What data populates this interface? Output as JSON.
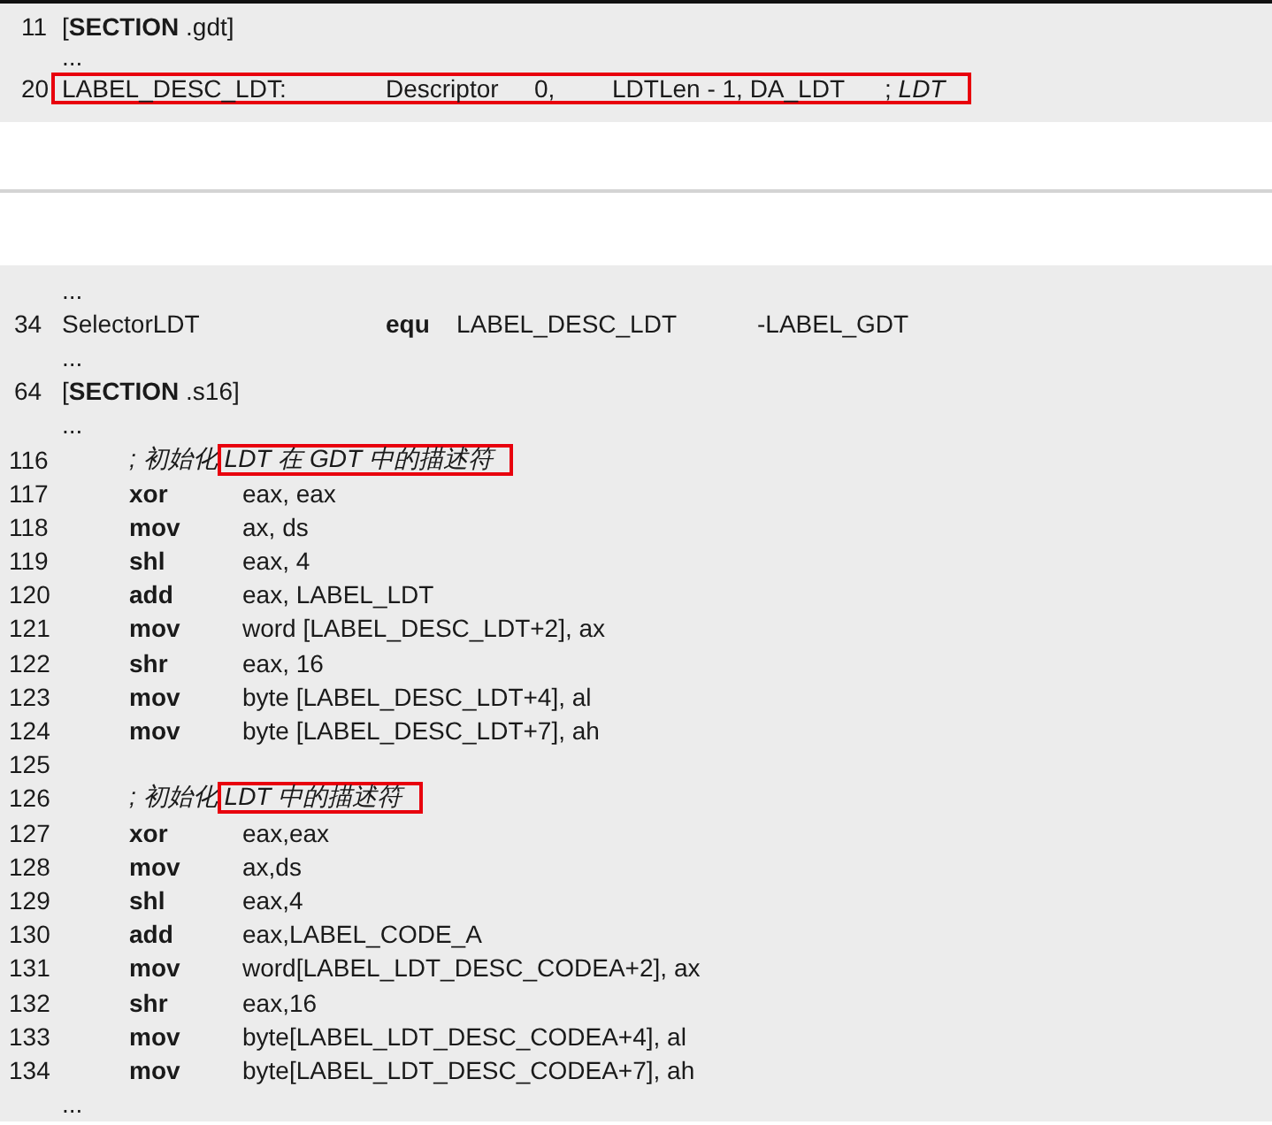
{
  "panels": [
    {
      "lines": [
        {
          "kind": "section",
          "num": "11",
          "text": "[**SECTION** .gdt]"
        },
        {
          "kind": "ellipsis",
          "text": "..."
        },
        {
          "kind": "directive",
          "num": "20",
          "highlighted": true,
          "label": "LABEL_DESC_LDT:",
          "macro": "Descriptor",
          "args": [
            "0,",
            "LDTLen - 1, DA_LDT"
          ],
          "comment": "; *LDT*"
        }
      ]
    },
    {
      "lines": [
        {
          "kind": "ellipsis",
          "text": "..."
        },
        {
          "kind": "equate",
          "num": "34",
          "label": "SelectorLDT",
          "op": "equ",
          "args": [
            "LABEL_DESC_LDT",
            "-LABEL_GDT"
          ]
        },
        {
          "kind": "ellipsis",
          "text": "..."
        },
        {
          "kind": "section",
          "num": "64",
          "text": "[**SECTION** .s16]"
        },
        {
          "kind": "ellipsis",
          "text": "..."
        },
        {
          "kind": "comment",
          "num": "116",
          "text": "; 初始化",
          "boxed": "LDT 在 GDT 中的描述符"
        },
        {
          "kind": "instruction",
          "num": "117",
          "op": "xor",
          "args": "eax, eax"
        },
        {
          "kind": "instruction",
          "num": "118",
          "op": "mov",
          "args": "ax, ds"
        },
        {
          "kind": "instruction",
          "num": "119",
          "op": "shl",
          "args": "eax, 4"
        },
        {
          "kind": "instruction",
          "num": "120",
          "op": "add",
          "args": "eax, LABEL_LDT"
        },
        {
          "kind": "instruction",
          "num": "121",
          "op": "mov",
          "args": "word [LABEL_DESC_LDT+2], ax"
        },
        {
          "kind": "instruction",
          "num": "122",
          "op": "shr",
          "args": "eax, 16"
        },
        {
          "kind": "instruction",
          "num": "123",
          "op": "mov",
          "args": "byte [LABEL_DESC_LDT+4], al"
        },
        {
          "kind": "instruction",
          "num": "124",
          "op": "mov",
          "args": "byte [LABEL_DESC_LDT+7], ah"
        },
        {
          "kind": "blank",
          "num": "125"
        },
        {
          "kind": "comment",
          "num": "126",
          "text": "; 初始化",
          "boxed": "LDT 中的描述符"
        },
        {
          "kind": "instruction",
          "num": "127",
          "op": "xor",
          "args": "eax,eax"
        },
        {
          "kind": "instruction",
          "num": "128",
          "op": "mov",
          "args": "ax,ds"
        },
        {
          "kind": "instruction",
          "num": "129",
          "op": "shl",
          "args": "eax,4"
        },
        {
          "kind": "instruction",
          "num": "130",
          "op": "add",
          "args": "eax,LABEL_CODE_A"
        },
        {
          "kind": "instruction",
          "num": "131",
          "op": "mov",
          "args": "word[LABEL_LDT_DESC_CODEA+2], ax"
        },
        {
          "kind": "instruction",
          "num": "132",
          "op": "shr",
          "args": "eax,16"
        },
        {
          "kind": "instruction",
          "num": "133",
          "op": "mov",
          "args": "byte[LABEL_LDT_DESC_CODEA+4], al"
        },
        {
          "kind": "instruction",
          "num": "134",
          "op": "mov",
          "args": "byte[LABEL_LDT_DESC_CODEA+7], ah"
        },
        {
          "kind": "ellipsis",
          "text": "..."
        }
      ]
    }
  ]
}
